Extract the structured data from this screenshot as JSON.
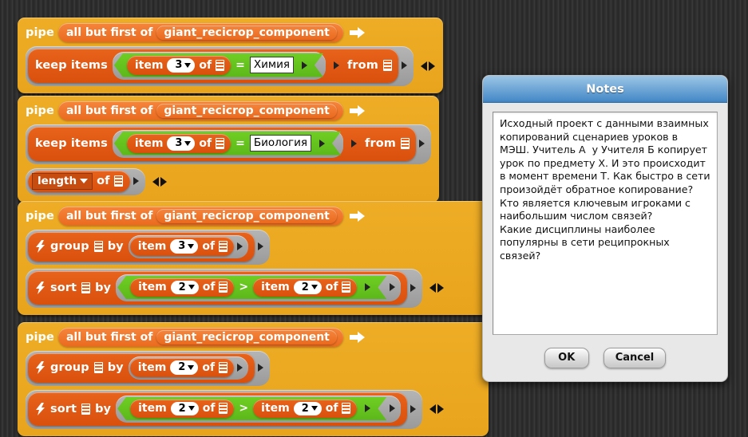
{
  "app": {
    "background_color": "#2b2b2b",
    "block_palette_color": "#eead26",
    "command_color": "#e8631c",
    "predicate_color": "#6fce23",
    "ring_color": "#aaaaaa"
  },
  "labels": {
    "pipe": "pipe",
    "all_but_first_of": "all but first of",
    "variable": "giant_recicrop_component",
    "keep_items": "keep items",
    "item": "item",
    "of": "of",
    "from": "from",
    "equals": "=",
    "greater_than": ">",
    "group": "group",
    "sort": "sort",
    "by": "by",
    "length": "length"
  },
  "icons": {
    "list": "list-icon",
    "bolt": "lightning-bolt-icon",
    "arrow_right_white": "arrow-right-icon",
    "expand": "expand-arrow-icon",
    "left_right": "left-right-arrows-icon",
    "dropdown_caret": "chevron-down-icon"
  },
  "scripts": [
    {
      "id": "script-1",
      "hat": {
        "label": "pipe",
        "operation": "all but first of",
        "variable": "giant_recicrop_component"
      },
      "rows": [
        {
          "type": "keep-items",
          "label": "keep items",
          "condition": {
            "left_index": "3",
            "comparator": "=",
            "right_value": "Химия"
          },
          "from_label": "from"
        }
      ]
    },
    {
      "id": "script-2",
      "hat": {
        "label": "pipe",
        "operation": "all but first of",
        "variable": "giant_recicrop_component"
      },
      "rows": [
        {
          "type": "keep-items",
          "label": "keep items",
          "condition": {
            "left_index": "3",
            "comparator": "=",
            "right_value": "Биология"
          },
          "from_label": "from"
        },
        {
          "type": "length-of",
          "selector": "length",
          "of_label": "of"
        }
      ]
    },
    {
      "id": "script-3",
      "hat": {
        "label": "pipe",
        "operation": "all but first of",
        "variable": "giant_recicrop_component"
      },
      "rows": [
        {
          "type": "group-by",
          "label": "group",
          "by_label": "by",
          "index": "3"
        },
        {
          "type": "sort-by",
          "label": "sort",
          "by_label": "by",
          "left_index": "2",
          "comparator": ">",
          "right_index": "2"
        }
      ]
    },
    {
      "id": "script-4",
      "hat": {
        "label": "pipe",
        "operation": "all but first of",
        "variable": "giant_recicrop_component"
      },
      "rows": [
        {
          "type": "group-by",
          "label": "group",
          "by_label": "by",
          "index": "2"
        },
        {
          "type": "sort-by",
          "label": "sort",
          "by_label": "by",
          "left_index": "2",
          "comparator": ">",
          "right_index": "2"
        }
      ]
    }
  ],
  "dialog": {
    "title": "Notes",
    "notes": "Исходный проект с данными взаимных копирований сценариев уроков в МЭШ. Учитель А  у Учителя Б копирует урок по предмету Х. И это происходит в момент времени Т. Как быстро в сети произойдёт обратное копирование?\nКто является ключевым игроками с наибольшим числом связей?\nКакие дисциплины наиболее популярны в сети реципрокных связей?",
    "ok_label": "OK",
    "cancel_label": "Cancel"
  }
}
